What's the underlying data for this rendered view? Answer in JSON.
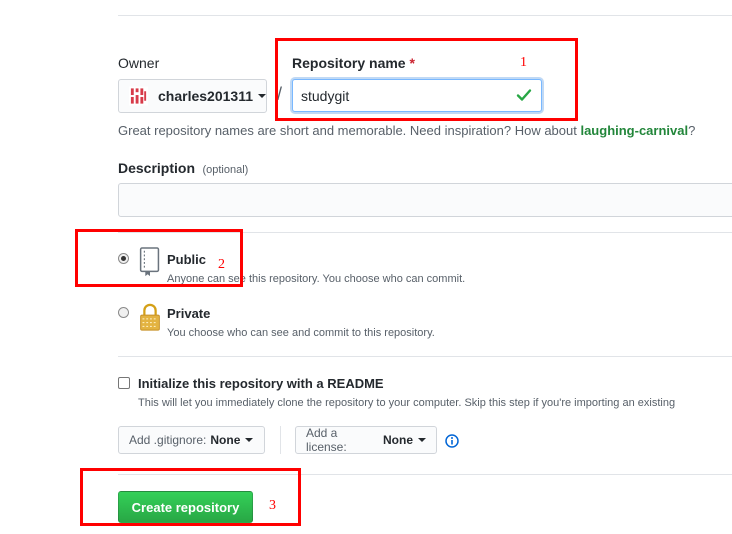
{
  "owner": {
    "label": "Owner",
    "selected": "charles201311"
  },
  "separator": "/",
  "repo_name": {
    "label": "Repository name",
    "required_mark": "*",
    "value": "studygit"
  },
  "hint": {
    "text": "Great repository names are short and memorable. Need inspiration? How about ",
    "suggestion": "laughing-carnival",
    "end": "?"
  },
  "description": {
    "label": "Description",
    "optional": "(optional)",
    "value": ""
  },
  "visibility": {
    "public": {
      "label": "Public",
      "note": "Anyone can see this repository. You choose who can commit.",
      "selected": true
    },
    "private": {
      "label": "Private",
      "note": "You choose who can see and commit to this repository.",
      "selected": false
    }
  },
  "readme": {
    "label": "Initialize this repository with a README",
    "note": "This will let you immediately clone the repository to your computer. Skip this step if you're importing an existing",
    "checked": false
  },
  "gitignore": {
    "prefix": "Add .gitignore:",
    "value": "None"
  },
  "license": {
    "prefix": "Add a license:",
    "value": "None"
  },
  "create_button": "Create repository",
  "annotations": {
    "one": "1",
    "two": "2",
    "three": "3",
    "color": "#ff0000"
  },
  "colors": {
    "accent_green": "#28a745",
    "link_green": "#22863a",
    "info_blue": "#0366d6"
  }
}
